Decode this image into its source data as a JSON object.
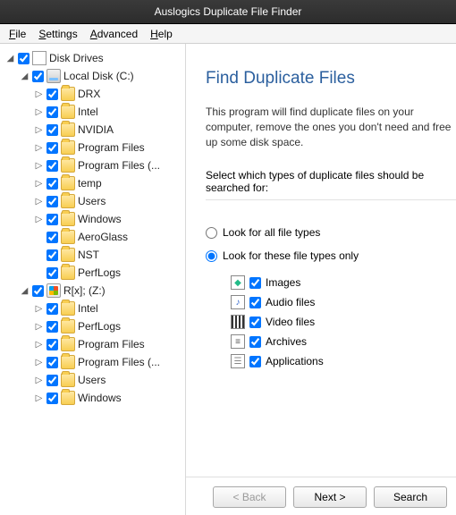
{
  "title": "Auslogics Duplicate File Finder",
  "menu": {
    "file": "File",
    "settings": "Settings",
    "advanced": "Advanced",
    "help": "Help"
  },
  "tree": {
    "root": "Disk Drives",
    "drives": [
      {
        "label": "Local Disk (C:)",
        "iconType": "drive",
        "children": [
          {
            "label": "DRX",
            "expandable": true
          },
          {
            "label": "Intel",
            "expandable": true
          },
          {
            "label": "NVIDIA",
            "expandable": true
          },
          {
            "label": "Program Files",
            "expandable": true
          },
          {
            "label": "Program Files (...",
            "expandable": true
          },
          {
            "label": "temp",
            "expandable": true
          },
          {
            "label": "Users",
            "expandable": true
          },
          {
            "label": "Windows",
            "expandable": true
          },
          {
            "label": "AeroGlass",
            "expandable": false
          },
          {
            "label": "NST",
            "expandable": false
          },
          {
            "label": "PerfLogs",
            "expandable": false
          }
        ]
      },
      {
        "label": "R[x]; (Z:)",
        "iconType": "drive-win",
        "children": [
          {
            "label": "Intel",
            "expandable": true
          },
          {
            "label": "PerfLogs",
            "expandable": true
          },
          {
            "label": "Program Files",
            "expandable": true
          },
          {
            "label": "Program Files (...",
            "expandable": true
          },
          {
            "label": "Users",
            "expandable": true
          },
          {
            "label": "Windows",
            "expandable": true
          }
        ]
      }
    ]
  },
  "main": {
    "heading": "Find Duplicate Files",
    "desc": "This program will find duplicate files on your computer, remove the ones you don't need and free up some disk space.",
    "selectLabel": "Select which types of duplicate files should be searched for:",
    "radioAll": "Look for all file types",
    "radioOnly": "Look for these file types only",
    "types": [
      {
        "label": "Images",
        "iconClass": "img",
        "glyph": "◆"
      },
      {
        "label": "Audio files",
        "iconClass": "aud",
        "glyph": "♪"
      },
      {
        "label": "Video files",
        "iconClass": "vid",
        "glyph": ""
      },
      {
        "label": "Archives",
        "iconClass": "arc",
        "glyph": "≡"
      },
      {
        "label": "Applications",
        "iconClass": "app",
        "glyph": "☰"
      }
    ]
  },
  "buttons": {
    "back": "< Back",
    "next": "Next >",
    "search": "Search"
  }
}
